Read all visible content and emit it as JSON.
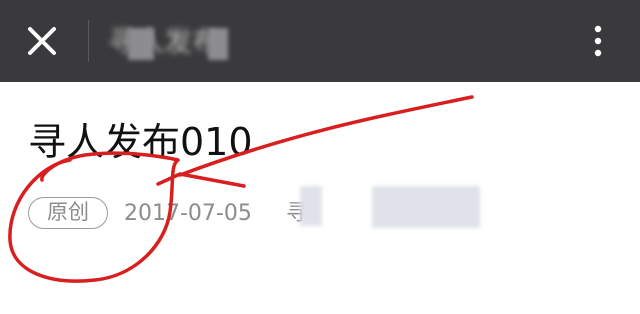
{
  "topbar": {
    "title": "寻人发布",
    "close_icon": "close-icon",
    "more_icon": "more-vertical-icon",
    "background": "#3a3a3c"
  },
  "article": {
    "title": "寻人发布010",
    "badge": "原创",
    "date": "2017-07-05",
    "author_prefix": "寻"
  },
  "annotation": {
    "color": "#d81e1e"
  }
}
